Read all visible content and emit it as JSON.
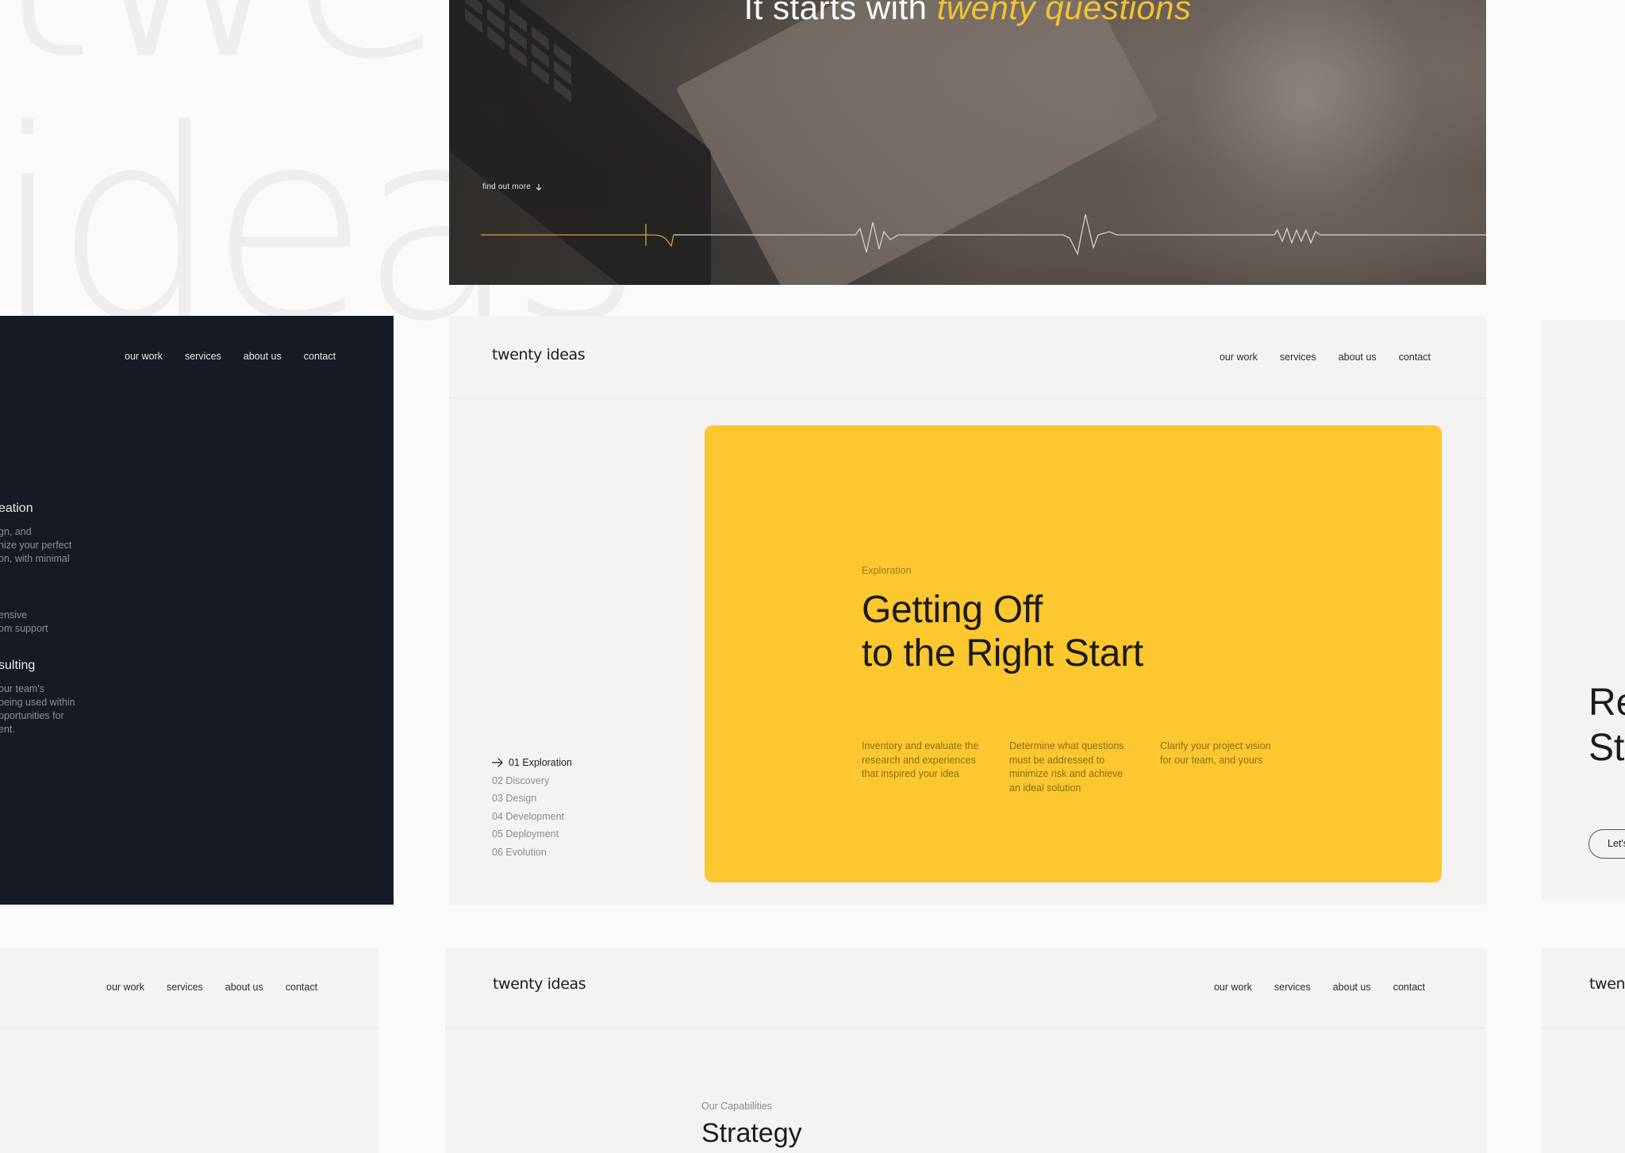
{
  "background": {
    "word_top": "twe",
    "word_bottom": "ideas"
  },
  "hero": {
    "title_main": "It starts with",
    "title_accent": "twenty questions",
    "find_more": "find out more",
    "accent_color": "#f5c22d"
  },
  "nav": {
    "our_work": "our work",
    "services": "services",
    "about_us": "about us",
    "contact": "contact"
  },
  "brand": {
    "logo": "twenty ideas",
    "logo_partial": "twen"
  },
  "dark_card": {
    "services": [
      {
        "title": "eation",
        "desc": [
          "gn, and",
          "nize your perfect",
          "on, with minimal"
        ]
      },
      {
        "title": "",
        "desc": [
          "ensive",
          "om support"
        ]
      },
      {
        "title": "sulting",
        "desc": [
          "our team's",
          "being used within",
          "pportunities for",
          "ent."
        ]
      }
    ]
  },
  "process": {
    "steps": [
      "01 Exploration",
      "02 Discovery",
      "03 Design",
      "04 Development",
      "05 Deployment",
      "06 Evolution"
    ],
    "active_index": 0,
    "eyebrow": "Exploration",
    "heading": "Getting Off\nto the Right Start",
    "columns": [
      "Inventory and evaluate the research and experiences that inspired your idea",
      "Determine what questions must be addressed to minimize risk and achieve an ideal solution",
      "Clarify your project vision for our team, and yours"
    ],
    "accent_color": "#fcc72f"
  },
  "right_card": {
    "heading": "Re\nSt",
    "button": "Let's"
  },
  "capabilities": {
    "eyebrow": "Our Capabilities",
    "title": "Strategy"
  }
}
